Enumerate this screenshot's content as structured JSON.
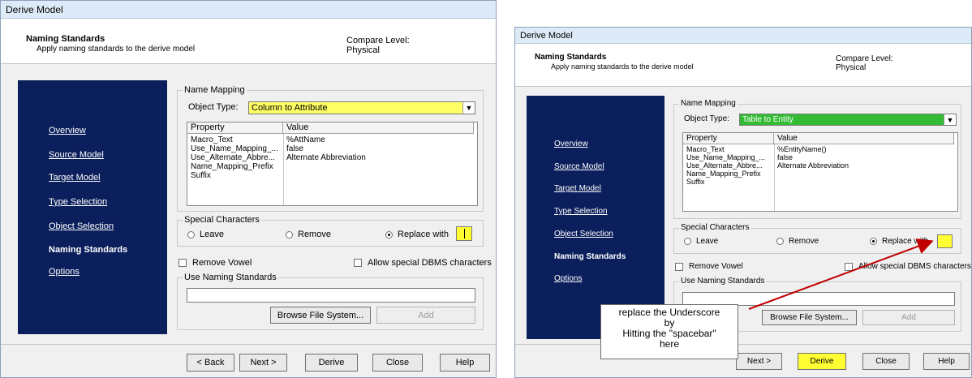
{
  "left": {
    "window_title": "Derive Model",
    "header": {
      "title": "Naming Standards",
      "subtitle": "Apply naming standards to the derive model",
      "compare_label": "Compare Level:",
      "compare_value": "Physical"
    },
    "nav": [
      {
        "label": "Overview"
      },
      {
        "label": "Source Model"
      },
      {
        "label": "Target Model"
      },
      {
        "label": "Type Selection"
      },
      {
        "label": "Object Selection"
      },
      {
        "label": "Naming Standards",
        "active": true
      },
      {
        "label": "Options"
      }
    ],
    "name_mapping": {
      "group_label": "Name Mapping",
      "object_type_label": "Object Type:",
      "object_type_value": "Column to Attribute",
      "columns": [
        "Property",
        "Value"
      ],
      "rows": [
        {
          "property": "Macro_Text",
          "value": "%AttName"
        },
        {
          "property": "Use_Name_Mapping_...",
          "value": "false"
        },
        {
          "property": "Use_Alternate_Abbre...",
          "value": "Alternate Abbreviation"
        },
        {
          "property": "Name_Mapping_Prefix",
          "value": ""
        },
        {
          "property": "Suffix",
          "value": ""
        }
      ]
    },
    "special_characters": {
      "group_label": "Special Characters",
      "leave": "Leave",
      "remove": "Remove",
      "replace_with": "Replace with",
      "selected": "replace_with"
    },
    "remove_vowel": "Remove Vowel",
    "allow_special": "Allow special DBMS characters",
    "use_naming": {
      "group_label": "Use Naming Standards",
      "input_value": "",
      "browse": "Browse File System...",
      "add": "Add"
    },
    "buttons": {
      "back": "< Back",
      "next": "Next >",
      "derive": "Derive",
      "close": "Close",
      "help": "Help"
    }
  },
  "right": {
    "window_title": "Derive Model",
    "header": {
      "title": "Naming Standards",
      "subtitle": "Apply naming standards to the derive model",
      "compare_label": "Compare Level:",
      "compare_value": "Physical"
    },
    "nav": [
      {
        "label": "Overview"
      },
      {
        "label": "Source Model"
      },
      {
        "label": "Target Model"
      },
      {
        "label": "Type Selection"
      },
      {
        "label": "Object Selection"
      },
      {
        "label": "Naming Standards",
        "active": true
      },
      {
        "label": "Options"
      }
    ],
    "name_mapping": {
      "group_label": "Name Mapping",
      "object_type_label": "Object Type:",
      "object_type_value": "Table to Entity",
      "columns": [
        "Property",
        "Value"
      ],
      "rows": [
        {
          "property": "Macro_Text",
          "value": "%EntityName()"
        },
        {
          "property": "Use_Name_Mapping_...",
          "value": "false"
        },
        {
          "property": "Use_Alternate_Abbre...",
          "value": "Alternate Abbreviation"
        },
        {
          "property": "Name_Mapping_Prefix",
          "value": ""
        },
        {
          "property": "Suffix",
          "value": ""
        }
      ]
    },
    "special_characters": {
      "group_label": "Special Characters",
      "leave": "Leave",
      "remove": "Remove",
      "replace_with": "Replace with",
      "selected": "replace_with"
    },
    "remove_vowel": "Remove Vowel",
    "allow_special": "Allow special DBMS characters",
    "use_naming": {
      "group_label": "Use Naming Standards",
      "input_value": "",
      "browse": "Browse File System...",
      "add": "Add"
    },
    "buttons": {
      "next": "Next >",
      "derive": "Derive",
      "close": "Close",
      "help": "Help"
    },
    "callout": {
      "line1": "replace the Underscore",
      "line2": "by",
      "line3": "Hitting the \"spacebar\"",
      "line4": "here"
    }
  },
  "colors": {
    "nav_bg": "#0b1f5c",
    "highlight_yellow": "#ffff33",
    "combo_yellow": "#ffff66",
    "combo_green": "#33bb33",
    "arrow_red": "#c00000"
  }
}
